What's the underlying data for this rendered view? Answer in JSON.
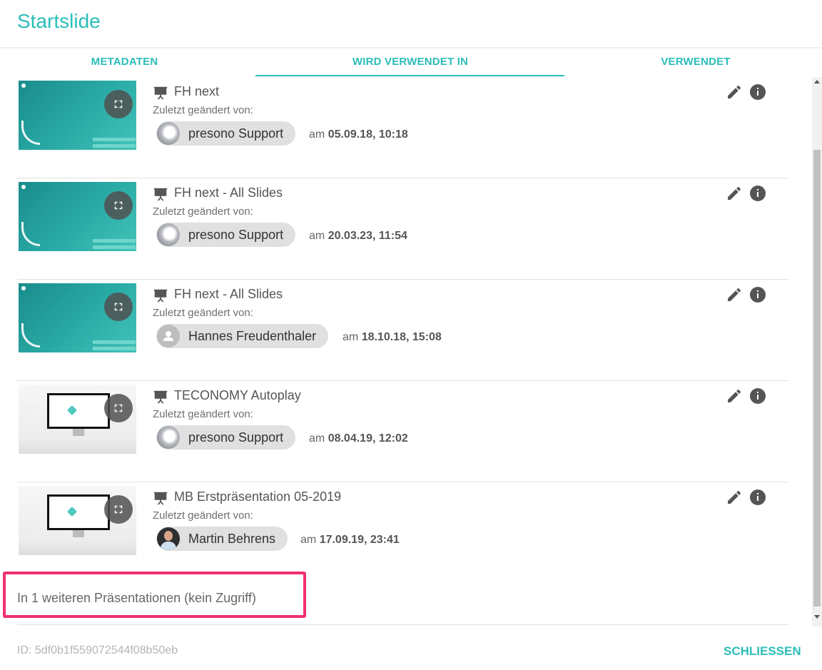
{
  "title": "Startslide",
  "tabs": [
    {
      "label": "METADATEN"
    },
    {
      "label": "WIRD VERWENDET IN"
    },
    {
      "label": "VERWENDET"
    }
  ],
  "active_tab": "WIRD VERWENDET IN",
  "changed_by_label": "Zuletzt geändert von:",
  "date_prefix": "am",
  "items": [
    {
      "title": "FH next",
      "user": "presono Support",
      "date": "05.09.18, 10:18",
      "thumb": "teal",
      "avatar": "photo"
    },
    {
      "title": "FH next - All Slides",
      "user": "presono Support",
      "date": "20.03.23, 11:54",
      "thumb": "teal",
      "avatar": "photo"
    },
    {
      "title": "FH next - All Slides",
      "user": "Hannes Freudenthaler",
      "date": "18.10.18, 15:08",
      "thumb": "teal",
      "avatar": "generic"
    },
    {
      "title": "TECONOMY Autoplay",
      "user": "presono Support",
      "date": "08.04.19, 12:02",
      "thumb": "mac",
      "avatar": "photo"
    },
    {
      "title": "MB Erstpräsentation 05-2019",
      "user": "Martin Behrens",
      "date": "17.09.19, 23:41",
      "thumb": "mac",
      "avatar": "person"
    }
  ],
  "more_text": "In 1 weiteren Präsentationen (kein Zugriff)",
  "id_text": "ID: 5df0b1f559072544f08b50eb",
  "close_label": "SCHLIESSEN",
  "icons": {
    "presentation": "presentation-icon",
    "expand": "expand-icon",
    "edit": "pencil-icon",
    "info": "info-icon"
  },
  "colors": {
    "accent": "#2bbdb9",
    "highlight_border": "#f0306e"
  }
}
